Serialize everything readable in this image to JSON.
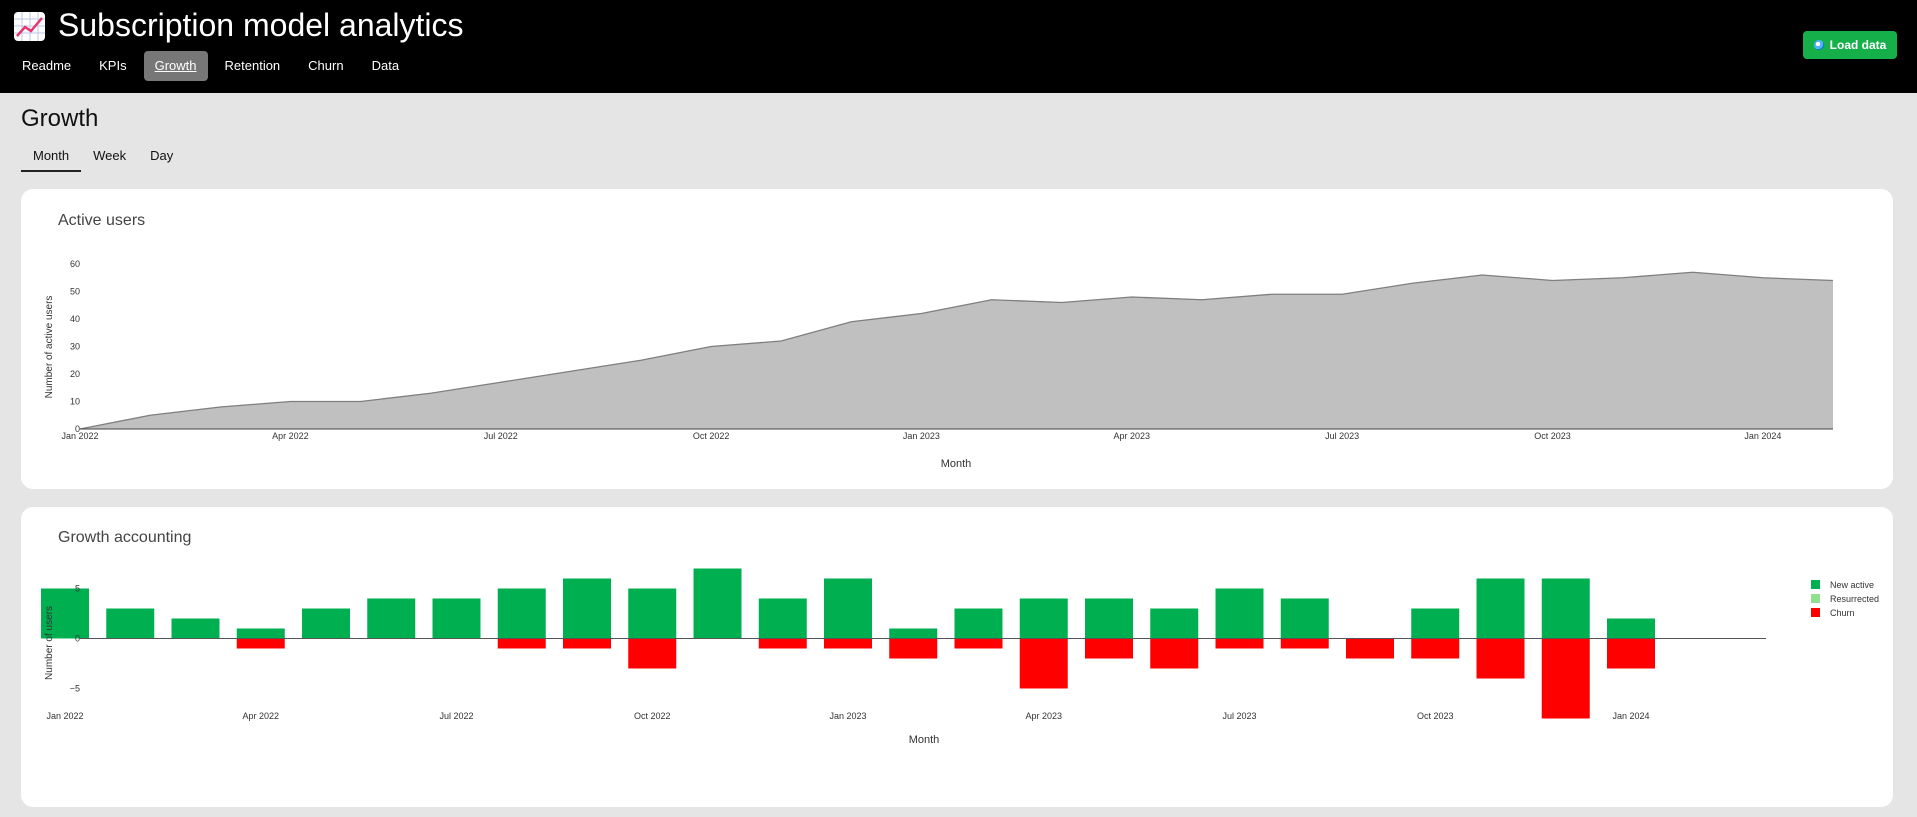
{
  "app": {
    "title": "Subscription model analytics",
    "load_button": "Load data",
    "logo_icon": "chart-increasing-icon"
  },
  "nav": [
    "Readme",
    "KPIs",
    "Growth",
    "Retention",
    "Churn",
    "Data"
  ],
  "nav_active": "Growth",
  "page": {
    "title": "Growth",
    "tabs": [
      "Month",
      "Week",
      "Day"
    ],
    "active_tab": "Month"
  },
  "colors": {
    "area_fill": "#c0c0c0",
    "area_line": "#7f7f7f",
    "new_active": "#00b050",
    "resurrected": "#90e090",
    "churn": "#ff0000",
    "button": "#16b04b"
  },
  "chart_data": [
    {
      "type": "area",
      "title": "Active users",
      "xlabel": "Month",
      "ylabel": "Number of active users",
      "ylim": [
        0,
        60
      ],
      "y_ticks": [
        0,
        10,
        20,
        30,
        40,
        50,
        60
      ],
      "x_ticks": [
        "Jan 2022",
        "Apr 2022",
        "Jul 2022",
        "Oct 2022",
        "Jan 2023",
        "Apr 2023",
        "Jul 2023",
        "Oct 2023",
        "Jan 2024"
      ],
      "x": [
        "2022-01",
        "2022-02",
        "2022-03",
        "2022-04",
        "2022-05",
        "2022-06",
        "2022-07",
        "2022-08",
        "2022-09",
        "2022-10",
        "2022-11",
        "2022-12",
        "2023-01",
        "2023-02",
        "2023-03",
        "2023-04",
        "2023-05",
        "2023-06",
        "2023-07",
        "2023-08",
        "2023-09",
        "2023-10",
        "2023-11",
        "2023-12",
        "2024-01",
        "2024-02"
      ],
      "values": [
        0,
        5,
        8,
        10,
        10,
        13,
        17,
        21,
        25,
        30,
        32,
        39,
        42,
        47,
        46,
        48,
        47,
        49,
        49,
        53,
        56,
        54,
        55,
        57,
        55,
        54
      ],
      "grid": false,
      "legend": "none"
    },
    {
      "type": "bar",
      "title": "Growth accounting",
      "xlabel": "Month",
      "ylabel": "Number of users",
      "ylim": [
        -8,
        8
      ],
      "y_ticks": [
        -5,
        0,
        5
      ],
      "x_ticks": [
        "Jan 2022",
        "Apr 2022",
        "Jul 2022",
        "Oct 2022",
        "Jan 2023",
        "Apr 2023",
        "Jul 2023",
        "Oct 2023",
        "Jan 2024"
      ],
      "categories": [
        "2022-01",
        "2022-02",
        "2022-03",
        "2022-04",
        "2022-05",
        "2022-06",
        "2022-07",
        "2022-08",
        "2022-09",
        "2022-10",
        "2022-11",
        "2022-12",
        "2023-01",
        "2023-02",
        "2023-03",
        "2023-04",
        "2023-05",
        "2023-06",
        "2023-07",
        "2023-08",
        "2023-09",
        "2023-10",
        "2023-11",
        "2023-12",
        "2024-01",
        "2024-02"
      ],
      "series": [
        {
          "name": "New active",
          "values": [
            5,
            3,
            2,
            1,
            3,
            4,
            4,
            5,
            6,
            5,
            7,
            4,
            6,
            1,
            3,
            4,
            4,
            3,
            5,
            4,
            0,
            3,
            6,
            6,
            2,
            0
          ]
        },
        {
          "name": "Resurrected",
          "values": [
            0,
            0,
            0,
            0,
            0,
            0,
            0,
            0,
            0,
            0,
            0,
            0,
            0,
            0,
            0,
            0,
            0,
            0,
            0,
            0,
            0,
            0,
            0,
            0,
            0,
            0
          ]
        },
        {
          "name": "Churn",
          "values": [
            0,
            0,
            0,
            -1,
            0,
            0,
            0,
            -1,
            -1,
            -3,
            0,
            -1,
            -1,
            -2,
            -1,
            -5,
            -2,
            -3,
            -1,
            -1,
            -2,
            -2,
            -4,
            -8,
            -3,
            0
          ]
        }
      ],
      "grid": false,
      "legend": "top-right"
    }
  ]
}
